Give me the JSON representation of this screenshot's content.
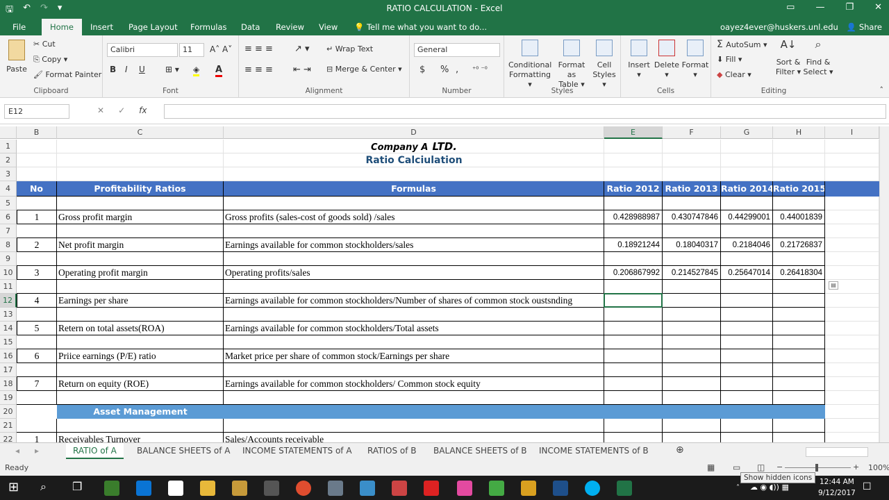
{
  "window": {
    "title": "RATIO CALCULATION - Excel"
  },
  "quick_access": {
    "save": "🖫",
    "undo": "↶",
    "redo": "↷",
    "customize": "▾"
  },
  "window_controls": {
    "ribbon_display": "▭",
    "minimize": "—",
    "restore": "❐",
    "close": "✕"
  },
  "menu": {
    "tabs": [
      "File",
      "Home",
      "Insert",
      "Page Layout",
      "Formulas",
      "Data",
      "Review",
      "View"
    ],
    "active": "Home",
    "tell_me": "Tell me what you want to do...",
    "user": "oayez4ever@huskers.unl.edu",
    "share": "Share"
  },
  "ribbon": {
    "clipboard": {
      "label": "Clipboard",
      "paste": "Paste",
      "cut": "Cut",
      "copy": "Copy",
      "format_painter": "Format Painter"
    },
    "font": {
      "label": "Font",
      "name": "Calibri",
      "size": "11",
      "bold": "B",
      "italic": "I",
      "underline": "U"
    },
    "alignment": {
      "label": "Alignment",
      "wrap": "Wrap Text",
      "merge": "Merge & Center"
    },
    "number": {
      "label": "Number",
      "format": "General",
      "currency": "$",
      "percent": "%",
      "comma": ","
    },
    "styles": {
      "label": "Styles",
      "conditional": "Conditional",
      "conditional2": "Formatting",
      "format_table": "Format as",
      "format_table2": "Table",
      "cell_styles": "Cell",
      "cell_styles2": "Styles"
    },
    "cells": {
      "label": "Cells",
      "insert": "Insert",
      "delete": "Delete",
      "format": "Format"
    },
    "editing": {
      "label": "Editing",
      "autosum": "AutoSum",
      "fill": "Fill",
      "clear": "Clear",
      "sort": "Sort &",
      "sort2": "Filter",
      "find": "Find &",
      "find2": "Select"
    }
  },
  "formula_bar": {
    "name_box": "E12",
    "fx": "fx",
    "cancel": "✕",
    "enter": "✓",
    "value": ""
  },
  "columns": [
    "B",
    "C",
    "D",
    "E",
    "F",
    "G",
    "H",
    "I"
  ],
  "rows": [
    "1",
    "2",
    "3",
    "4",
    "5",
    "6",
    "7",
    "8",
    "9",
    "10",
    "11",
    "12",
    "13",
    "14",
    "15",
    "16",
    "17",
    "18",
    "19",
    "20",
    "21",
    "22"
  ],
  "sheet": {
    "company": "Company A",
    "ltd": "LTD.",
    "subtitle": "Ratio Calciulation",
    "headers": {
      "no": "No",
      "ratio": "Profitability Ratios",
      "formula": "Formulas",
      "y2012": "Ratio 2012",
      "y2013": "Ratio 2013",
      "y2014": "Ratio 2014",
      "y2015": "Ratio 2015"
    },
    "items": [
      {
        "no": "1",
        "name": "Gross profit margin",
        "formula": "Gross profits (sales-cost of goods sold) /sales",
        "v2012": "0.428988987",
        "v2013": "0.430747846",
        "v2014": "0.44299001",
        "v2015": "0.44001839"
      },
      {
        "no": "2",
        "name": "Net profit margin",
        "formula": "Earnings available for common  stockholders/sales",
        "v2012": "0.18921244",
        "v2013": "0.18040317",
        "v2014": "0.2184046",
        "v2015": "0.21726837"
      },
      {
        "no": "3",
        "name": "Operating profit margin",
        "formula": "Operating profits/sales",
        "v2012": "0.206867992",
        "v2013": "0.214527845",
        "v2014": "0.25647014",
        "v2015": "0.26418304"
      },
      {
        "no": "4",
        "name": "Earnings per share",
        "formula": "Earnings available for common stockholders/Number of shares of common stock oustsnding",
        "v2012": "",
        "v2013": "",
        "v2014": "",
        "v2015": ""
      },
      {
        "no": "5",
        "name": "Retern on total assets(ROA)",
        "formula": "Earnings available for common stockholders/Total assets",
        "v2012": "",
        "v2013": "",
        "v2014": "",
        "v2015": ""
      },
      {
        "no": "6",
        "name": "Priice earnings (P/E) ratio",
        "formula": "Market price per share of common stock/Earnings per share",
        "v2012": "",
        "v2013": "",
        "v2014": "",
        "v2015": ""
      },
      {
        "no": "7",
        "name": "Return on equity (ROE)",
        "formula": "Earnings available for common stockholders/ Common stock equity",
        "v2012": "",
        "v2013": "",
        "v2014": "",
        "v2015": ""
      }
    ],
    "section2": "Asset Management",
    "row22": {
      "no": "1",
      "name": "Receivables Turnover",
      "formula": "Sales/Accounts receivable"
    }
  },
  "tabs": [
    "RATIO of A",
    "BALANCE SHEETS of A",
    "INCOME STATEMENTS of A",
    "RATIOS of B",
    "BALANCE SHEETS of B",
    "INCOME STATEMENTS of B"
  ],
  "status": {
    "ready": "Ready",
    "zoom": "100%"
  },
  "taskbar": {
    "time": "12:44 AM",
    "date": "9/12/2017",
    "tooltip": "Show hidden icons"
  },
  "colors": {
    "excel_green": "#217346",
    "header_blue": "#4472c4",
    "section_blue": "#5b9bd5"
  }
}
